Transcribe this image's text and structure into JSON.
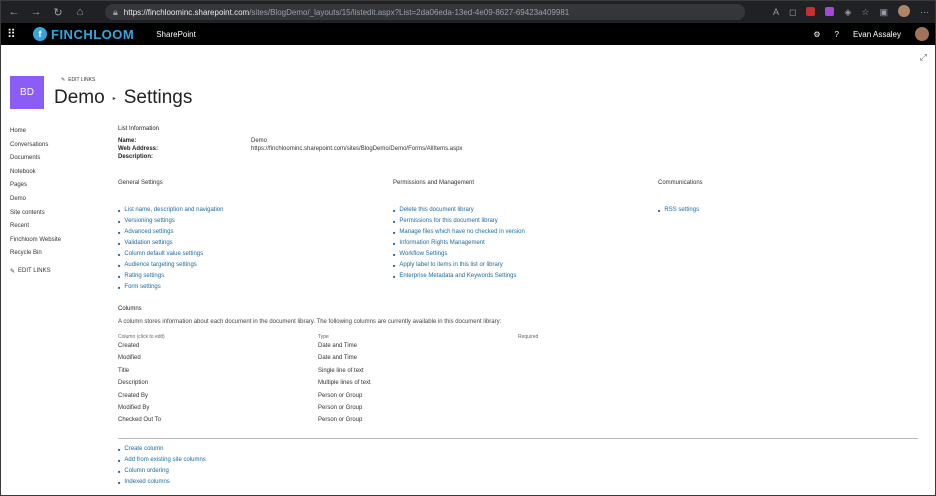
{
  "browser": {
    "url_host": "https://finchloominc.sharepoint.com",
    "url_path": "/sites/BlogDemo/_layouts/15/listedit.aspx?List=2da06eda-13ed-4e09-8627-69423a409981"
  },
  "suite": {
    "brand": "FINCHLOOM",
    "app_name": "SharePoint",
    "user_name": "Evan Assaley"
  },
  "site": {
    "logo_initials": "BD",
    "edit_links": "EDIT LINKS",
    "title": "Demo",
    "page": "Settings"
  },
  "leftnav": {
    "items": [
      "Home",
      "Conversations",
      "Documents",
      "Notebook",
      "Pages",
      "Demo",
      "Site contents",
      "Recent",
      "Finchloom Website",
      "Recycle Bin"
    ],
    "edit_links": "EDIT LINKS"
  },
  "list_info": {
    "heading": "List Information",
    "name_label": "Name:",
    "name_value": "Demo",
    "web_label": "Web Address:",
    "web_value": "https://finchloominc.sharepoint.com/sites/BlogDemo/Demo/Forms/AllItems.aspx",
    "desc_label": "Description:"
  },
  "general": {
    "heading": "General Settings",
    "links": [
      "List name, description and navigation",
      "Versioning settings",
      "Advanced settings",
      "Validation settings",
      "Column default value settings",
      "Audience targeting settings",
      "Rating settings",
      "Form settings"
    ]
  },
  "permissions": {
    "heading": "Permissions and Management",
    "links": [
      "Delete this document library",
      "Permissions for this document library",
      "Manage files which have no checked in version",
      "Information Rights Management",
      "Workflow Settings",
      "Apply label to items in this list or library",
      "Enterprise Metadata and Keywords Settings"
    ]
  },
  "communications": {
    "heading": "Communications",
    "links": [
      "RSS settings"
    ]
  },
  "columns": {
    "heading": "Columns",
    "description": "A column stores information about each document in the document library. The following columns are currently available in this document library:",
    "header_column": "Column (click to edit)",
    "header_type": "Type",
    "header_required": "Required",
    "rows": [
      {
        "name": "Created",
        "type": "Date and Time"
      },
      {
        "name": "Modified",
        "type": "Date and Time"
      },
      {
        "name": "Title",
        "type": "Single line of text"
      },
      {
        "name": "Description",
        "type": "Multiple lines of text"
      },
      {
        "name": "Created By",
        "type": "Person or Group"
      },
      {
        "name": "Modified By",
        "type": "Person or Group"
      },
      {
        "name": "Checked Out To",
        "type": "Person or Group"
      }
    ],
    "links": [
      "Create column",
      "Add from existing site columns",
      "Column ordering",
      "Indexed columns"
    ]
  }
}
